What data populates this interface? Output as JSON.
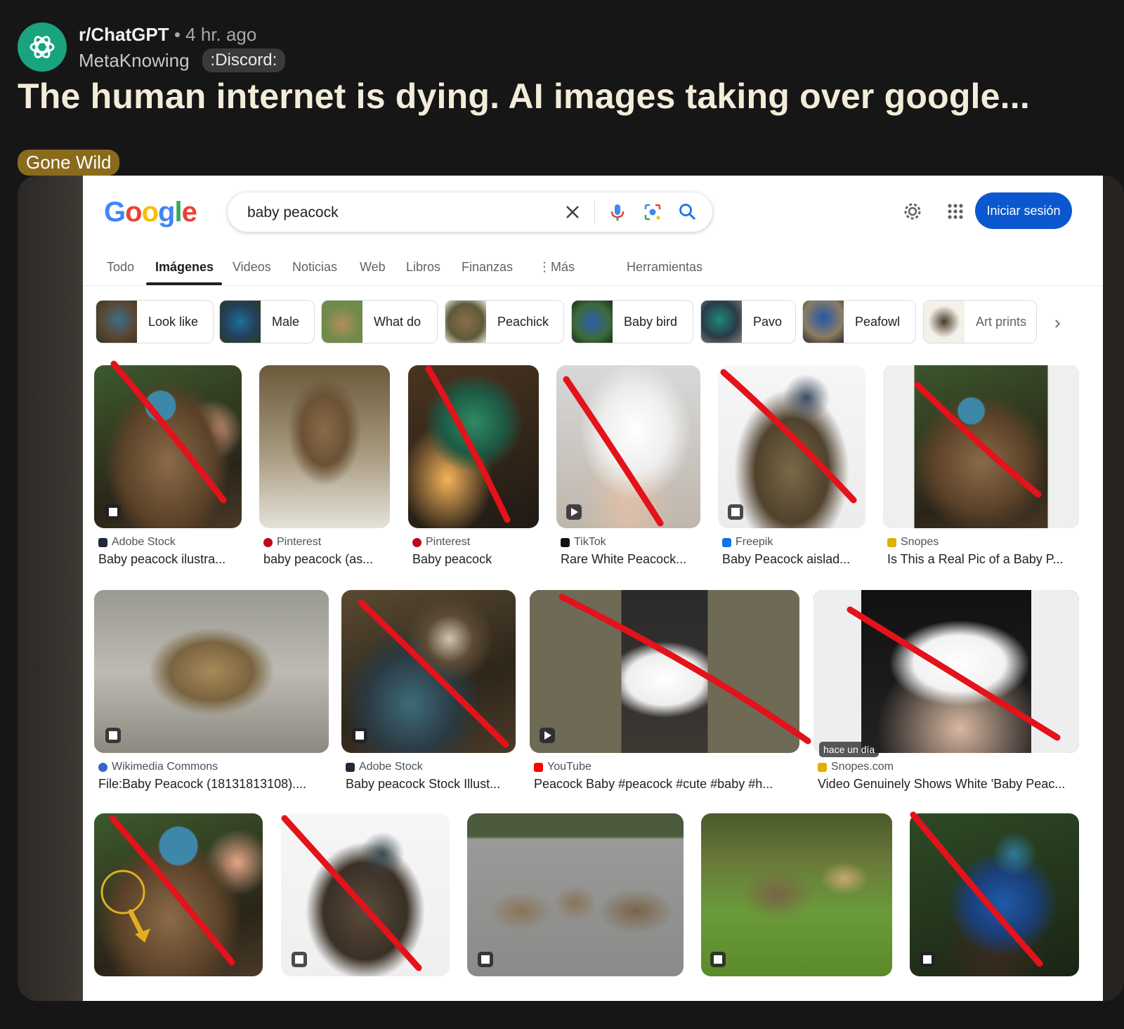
{
  "post": {
    "subreddit": "r/ChatGPT",
    "separator": "•",
    "age": "4 hr. ago",
    "author": "MetaKnowing",
    "author_flair": ":Discord:",
    "title": "The human internet is dying. AI images taking over google...",
    "flair": "Gone Wild",
    "avatar_icon": "openai-logo-icon",
    "avatar_color": "#19a37f",
    "flair_color": "#8a6a1c"
  },
  "google": {
    "logo": [
      "G",
      "o",
      "o",
      "g",
      "l",
      "e"
    ],
    "logo_colors": [
      "#4285f4",
      "#ea4335",
      "#fbbc05",
      "#4285f4",
      "#34a853",
      "#ea4335"
    ],
    "query": "baby peacock",
    "sign_in": "Iniciar sesión",
    "tabs": [
      "Todo",
      "Imágenes",
      "Videos",
      "Noticias",
      "Web",
      "Libros",
      "Finanzas",
      "Más",
      "Herramientas"
    ],
    "active_tab": "Imágenes",
    "chips": [
      "Look like",
      "Male",
      "What do",
      "Peachick",
      "Baby bird",
      "Pavo",
      "Peafowl",
      "Art prints"
    ]
  },
  "results": {
    "row1": [
      {
        "source": "Adobe Stock",
        "title": "Baby peacock ilustra...",
        "crossed": true,
        "media": "image",
        "color": "#1f2a3a"
      },
      {
        "source": "Pinterest",
        "title": "baby peacock (as...",
        "crossed": false,
        "media": "none",
        "color": "#bd081c"
      },
      {
        "source": "Pinterest",
        "title": "Baby peacock",
        "crossed": true,
        "media": "none",
        "color": "#bd081c"
      },
      {
        "source": "TikTok",
        "title": "Rare White Peacock...",
        "crossed": true,
        "media": "video",
        "color": "#111111"
      },
      {
        "source": "Freepik",
        "title": "Baby Peacock aislad...",
        "crossed": true,
        "media": "image",
        "color": "#1273eb"
      },
      {
        "source": "Snopes",
        "title": "Is This a Real Pic of a Baby P...",
        "crossed": true,
        "media": "none",
        "color": "#e0b000"
      }
    ],
    "row2": [
      {
        "source": "Wikimedia Commons",
        "title": "File:Baby Peacock (18131813108)....",
        "crossed": false,
        "media": "image",
        "color": "#3366cc"
      },
      {
        "source": "Adobe Stock",
        "title": "Baby peacock Stock Illust...",
        "crossed": true,
        "media": "image",
        "color": "#1f2a3a"
      },
      {
        "source": "YouTube",
        "title": "Peacock Baby #peacock #cute #baby #h...",
        "crossed": true,
        "media": "video",
        "color": "#ff0000"
      },
      {
        "source": "Snopes.com",
        "title": "Video Genuinely Shows White 'Baby Peac...",
        "crossed": true,
        "media": "hace un día",
        "color": "#e0b000"
      }
    ],
    "row3": [
      {
        "crossed": true,
        "media": "none"
      },
      {
        "crossed": true,
        "media": "image"
      },
      {
        "crossed": false,
        "media": "image"
      },
      {
        "crossed": false,
        "media": "image"
      },
      {
        "crossed": true,
        "media": "image"
      }
    ]
  }
}
